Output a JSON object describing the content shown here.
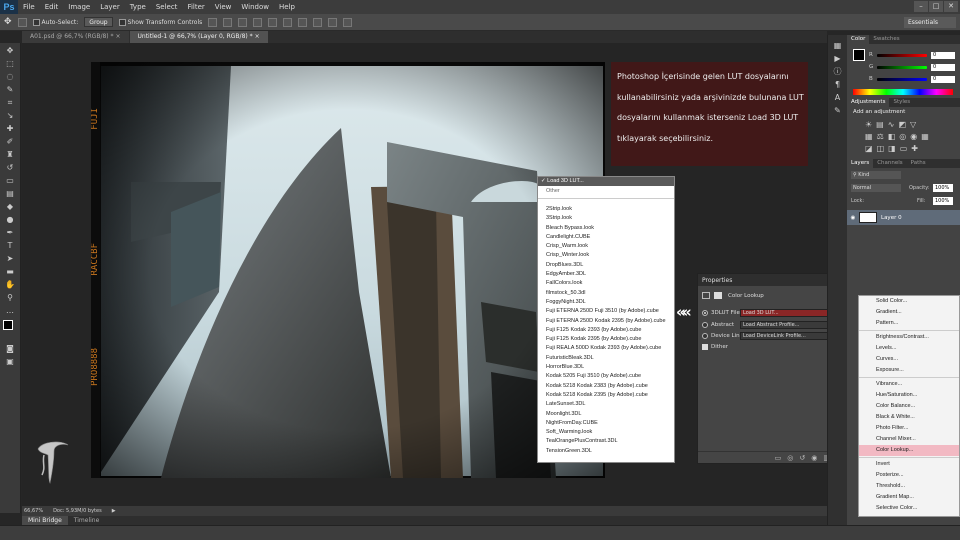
{
  "app": {
    "logo": "Ps"
  },
  "menubar": {
    "items": [
      "File",
      "Edit",
      "Image",
      "Layer",
      "Type",
      "Select",
      "Filter",
      "View",
      "Window",
      "Help"
    ]
  },
  "window_controls": [
    "–",
    "□",
    "✕"
  ],
  "options_bar": {
    "auto_select_label": "Auto-Select:",
    "auto_select_value": "Group",
    "transform_label": "Show Transform Controls",
    "workspace": "Essentials"
  },
  "doc_tabs": [
    {
      "label": "A01.psd @ 66,7% (RGB/8) *",
      "close": "×"
    },
    {
      "label": "Untitled-1 @ 66,7% (Layer 0, RGB/8) *",
      "close": "×"
    }
  ],
  "film_text": {
    "left_top": "FUJI",
    "left_mid": "RACCBF",
    "left_bottom": "PRO8888"
  },
  "status": {
    "zoom": "66,67%",
    "doc": "Doc: 5,93M/0 bytes"
  },
  "bottom_tabs": [
    "Mini Bridge",
    "Timeline"
  ],
  "note": {
    "text": "Photoshop İçerisinde gelen LUT dosyalarını kullanabilirsiniz yada arşivinizde bulunana LUT dosyalarını kullanmak isterseniz Load 3D LUT tıklayarak seçebilirsiniz."
  },
  "lut_dropdown": {
    "selected": "Load 3D LUT...",
    "other": "Other",
    "items": [
      "2Strip.look",
      "3Strip.look",
      "Bleach Bypass.look",
      "Candlelight.CUBE",
      "Crisp_Warm.look",
      "Crisp_Winter.look",
      "DropBlues.3DL",
      "EdgyAmber.3DL",
      "FallColors.look",
      "filmstock_50.3dl",
      "FoggyNight.3DL",
      "Fuji ETERNA 250D Fuji 3510 (by Adobe).cube",
      "Fuji ETERNA 250D Kodak 2395 (by Adobe).cube",
      "Fuji F125 Kodak 2393 (by Adobe).cube",
      "Fuji F125 Kodak 2395 (by Adobe).cube",
      "Fuji REALA 500D Kodak 2393 (by Adobe).cube",
      "FuturisticBleak.3DL",
      "HorrorBlue.3DL",
      "Kodak 5205 Fuji 3510 (by Adobe).cube",
      "Kodak 5218 Kodak 2383 (by Adobe).cube",
      "Kodak 5218 Kodak 2395 (by Adobe).cube",
      "LateSunset.3DL",
      "Moonlight.3DL",
      "NightFromDay.CUBE",
      "Soft_Warming.look",
      "TealOrangePlusContrast.3DL",
      "TensionGreen.3DL"
    ]
  },
  "properties": {
    "title": "Properties",
    "subtitle": "Color Lookup",
    "rows": [
      {
        "label": "3DLUT File",
        "value": "Load 3D LUT..."
      },
      {
        "label": "Abstract",
        "value": "Load Abstract Profile..."
      },
      {
        "label": "Device Link",
        "value": "Load DeviceLink Profile..."
      }
    ],
    "dither": "Dither"
  },
  "adjust_menu": {
    "groups": [
      [
        "Solid Color...",
        "Gradient...",
        "Pattern..."
      ],
      [
        "Brightness/Contrast...",
        "Levels...",
        "Curves...",
        "Exposure..."
      ],
      [
        "Vibrance...",
        "Hue/Saturation...",
        "Color Balance...",
        "Black & White...",
        "Photo Filter...",
        "Channel Mixer...",
        "Color Lookup..."
      ],
      [
        "Invert",
        "Posterize...",
        "Threshold...",
        "Gradient Map...",
        "Selective Color..."
      ]
    ],
    "highlighted": "Color Lookup..."
  },
  "color_panel": {
    "tabs": [
      "Color",
      "Swatches"
    ],
    "channels": [
      {
        "label": "R",
        "value": "0"
      },
      {
        "label": "G",
        "value": "0"
      },
      {
        "label": "B",
        "value": "0"
      }
    ]
  },
  "adjustments_panel": {
    "tabs": [
      "Adjustments",
      "Styles"
    ],
    "subtitle": "Add an adjustment"
  },
  "layers_panel": {
    "tabs": [
      "Layers",
      "Channels",
      "Paths"
    ],
    "kind": "Kind",
    "blend": "Normal",
    "opacity_label": "Opacity:",
    "opacity": "100%",
    "lock_label": "Lock:",
    "fill_label": "Fill:",
    "fill": "100%",
    "layer_name": "Layer 0"
  },
  "arrows": "«"
}
